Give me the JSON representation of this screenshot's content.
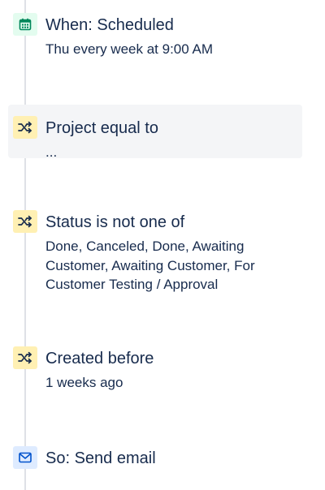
{
  "steps": [
    {
      "id": "when",
      "title": "When: Scheduled",
      "description": "Thu every week at 9:00 AM",
      "icon": "calendar-icon",
      "kind": "trigger"
    },
    {
      "id": "project",
      "title": "Project equal to",
      "description": "...",
      "icon": "shuffle-icon",
      "kind": "condition"
    },
    {
      "id": "status",
      "title": "Status is not one of",
      "description": "Done, Canceled, Done, Awaiting Customer, Awaiting Customer, For Customer Testing / Approval",
      "icon": "shuffle-icon",
      "kind": "condition"
    },
    {
      "id": "created",
      "title": "Created before",
      "description": "1 weeks ago",
      "icon": "shuffle-icon",
      "kind": "condition"
    },
    {
      "id": "send-email",
      "title": "So: Send email",
      "icon": "envelope-icon",
      "kind": "action"
    }
  ],
  "colors": {
    "trigger_bg": "#E3FCEF",
    "trigger_icon": "#00875A",
    "condition_bg": "#FFF0B3",
    "condition_icon": "#172B4D",
    "action_bg": "#DEEBFF",
    "action_icon": "#0052CC",
    "rail": "#DFE1E6",
    "highlight_bg": "#F4F5F7"
  }
}
